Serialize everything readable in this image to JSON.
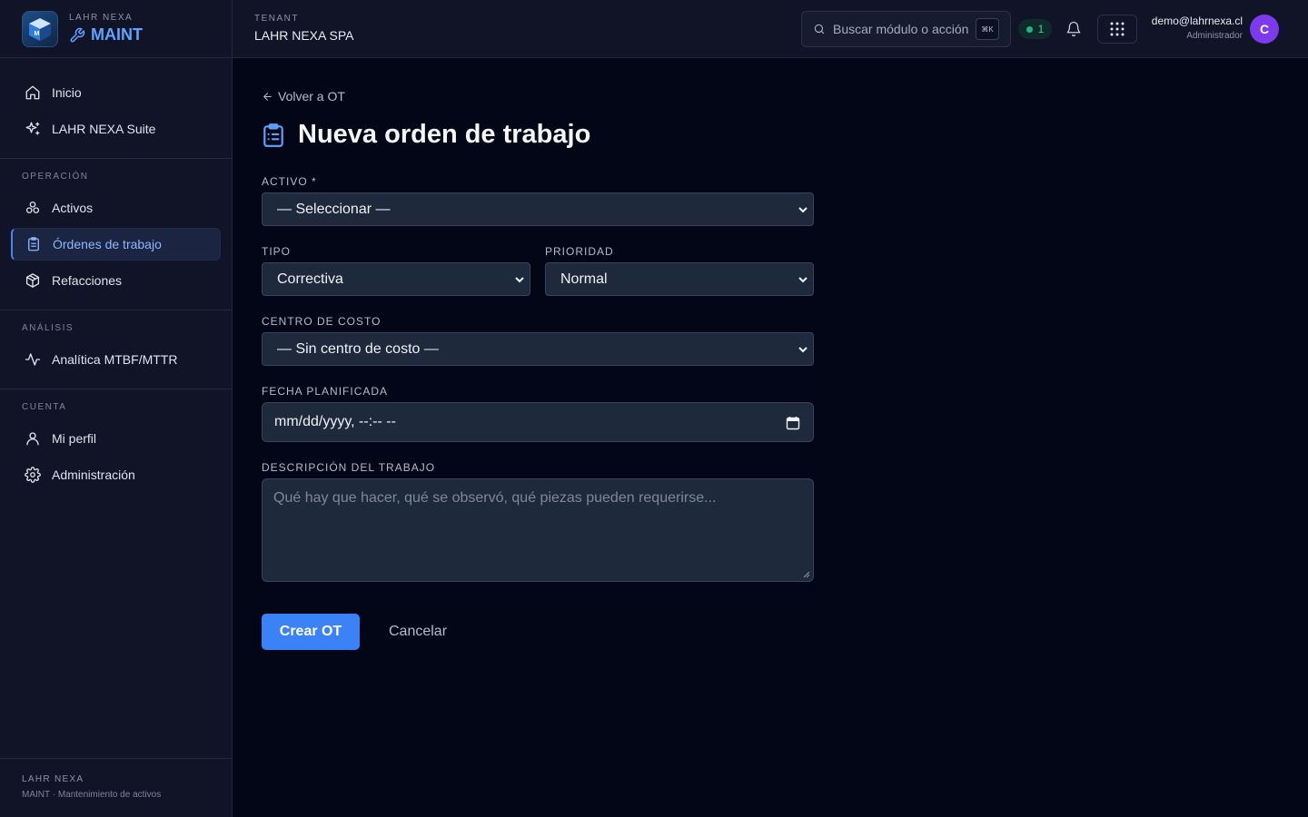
{
  "brand": {
    "sup": "LAHR NEXA",
    "name": "MAINT",
    "logo_letter": "M"
  },
  "sidebar": {
    "top_items": [
      {
        "label": "Inicio",
        "icon": "home-icon"
      },
      {
        "label": "LAHR NEXA Suite",
        "icon": "sparkle-icon"
      }
    ],
    "sections": [
      {
        "title": "OPERACIÓN",
        "items": [
          {
            "label": "Activos",
            "icon": "assets-icon"
          },
          {
            "label": "Órdenes de trabajo",
            "icon": "clipboard-icon",
            "active": true
          },
          {
            "label": "Refacciones",
            "icon": "package-icon"
          }
        ]
      },
      {
        "title": "ANÁLISIS",
        "items": [
          {
            "label": "Analítica MTBF/MTTR",
            "icon": "activity-icon"
          }
        ]
      },
      {
        "title": "CUENTA",
        "items": [
          {
            "label": "Mi perfil",
            "icon": "user-icon"
          },
          {
            "label": "Administración",
            "icon": "gear-icon"
          }
        ]
      }
    ],
    "footer": {
      "line1": "LAHR NEXA",
      "line2": "MAINT · Mantenimiento de activos"
    }
  },
  "header": {
    "tenant_label": "TENANT",
    "tenant_name": "LAHR NEXA SPA",
    "search_placeholder": "Buscar módulo o acción",
    "search_shortcut": "⌘K",
    "status_count": "1",
    "user_email": "demo@lahrnexa.cl",
    "user_role": "Administrador",
    "avatar_initial": "C"
  },
  "form": {
    "back_label": "Volver a OT",
    "title": "Nueva orden de trabajo",
    "activo_label": "ACTIVO",
    "activo_required": "*",
    "activo_value": "— Seleccionar —",
    "tipo_label": "TIPO",
    "tipo_value": "Correctiva",
    "prioridad_label": "PRIORIDAD",
    "prioridad_value": "Normal",
    "centro_label": "CENTRO DE COSTO",
    "centro_value": "— Sin centro de costo —",
    "fecha_label": "FECHA PLANIFICADA",
    "fecha_value": "mm/dd/yyyy, --:-- --",
    "descripcion_label": "DESCRIPCIÓN DEL TRABAJO",
    "descripcion_placeholder": "Qué hay que hacer, qué se observó, qué piezas pueden requerirse...",
    "submit_label": "Crear OT",
    "cancel_label": "Cancelar"
  },
  "colors": {
    "accent": "#3b82f6",
    "brand": "#5fa3ff",
    "avatar": "#7c3aed",
    "status": "#1fb584"
  }
}
